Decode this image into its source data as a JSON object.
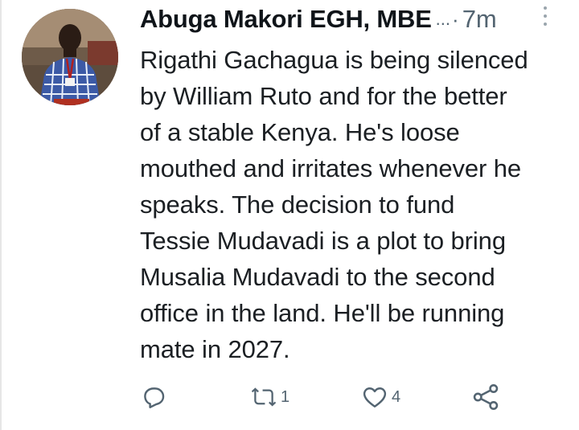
{
  "author": {
    "display_name": "Abuga Makori EGH, MBE",
    "truncation": "...",
    "separator": "·",
    "time": "7m"
  },
  "tweet": {
    "text": "Rigathi Gachagua is being silenced\nby William Ruto and for the better\nof a stable Kenya. He's loose\nmouthed and irritates whenever he\nspeaks. The decision to fund\nTessie Mudavadi is a plot to bring\nMusalia Mudavadi to the second\noffice in the land. He'll be running\nmate in 2027."
  },
  "actions": {
    "reply": {
      "icon": "reply-icon",
      "count": ""
    },
    "retweet": {
      "icon": "retweet-icon",
      "count": "1"
    },
    "like": {
      "icon": "heart-icon",
      "count": "4"
    },
    "share": {
      "icon": "share-icon",
      "count": ""
    }
  },
  "colors": {
    "text": "#0f1419",
    "muted": "#536471",
    "icon": "#536471",
    "background": "#ffffff"
  }
}
